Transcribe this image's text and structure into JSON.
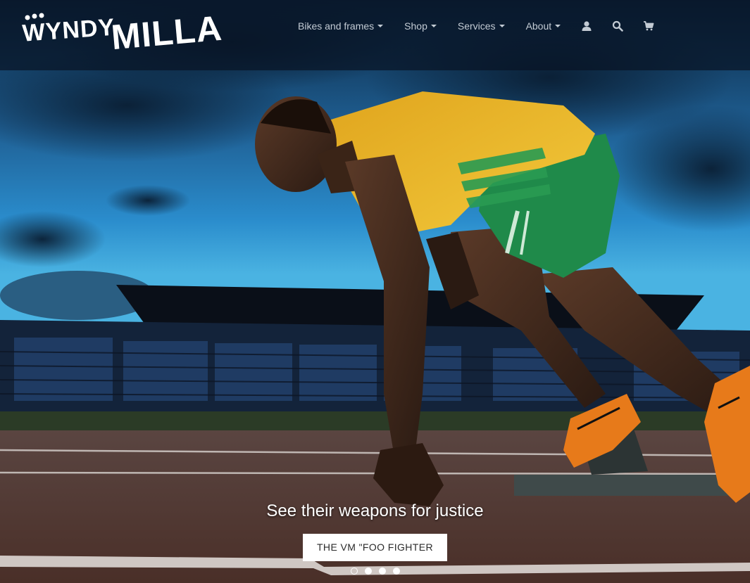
{
  "brand": {
    "logo_text_1": "WYNDY",
    "logo_text_2": "MILLA",
    "logo_color": "#ffffff"
  },
  "nav": {
    "items": [
      {
        "label": "Bikes and frames",
        "dropdown": true
      },
      {
        "label": "Shop",
        "dropdown": true
      },
      {
        "label": "Services",
        "dropdown": true
      },
      {
        "label": "About",
        "dropdown": true
      }
    ],
    "icons": [
      "user-icon",
      "search-icon",
      "cart-icon"
    ],
    "text_color": "#c3cbd4"
  },
  "hero": {
    "image": "sprinter-in-starting-blocks-stadium",
    "caption_title": "See their weapons for justice",
    "caption_button": "THE VM \"FOO FIGHTER",
    "slide_count": 4,
    "active_slide": 1
  }
}
